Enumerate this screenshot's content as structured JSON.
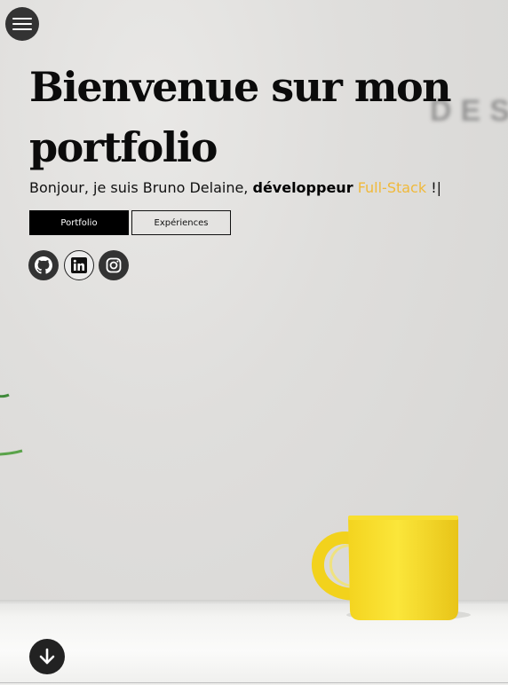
{
  "header": {
    "title": "Bienvenue sur mon portfolio",
    "intro": "Bonjour, je suis Bruno Delaine, ",
    "role": "développeur",
    "stack": "Full-Stack",
    "suffix": " !",
    "cursor": "|"
  },
  "background": {
    "deco_text": "DES"
  },
  "actions": {
    "portfolio_label": "Portfolio",
    "experiences_label": "Expériences"
  },
  "social": [
    {
      "icon": "github-icon"
    },
    {
      "icon": "linkedin-icon"
    },
    {
      "icon": "instagram-icon"
    }
  ],
  "icons": {
    "menu": "hamburger-menu-icon",
    "scroll": "arrow-down-icon"
  },
  "colors": {
    "accent": "#f0b93a",
    "dark": "#333333",
    "mug": "#f7df2f"
  }
}
